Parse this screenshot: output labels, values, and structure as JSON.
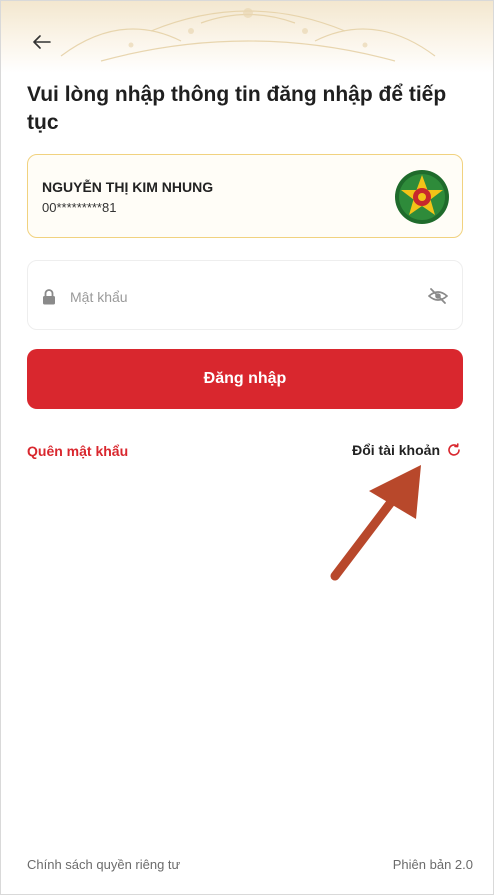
{
  "header": {
    "back_icon": "arrow-left-icon"
  },
  "title": "Vui lòng nhập thông tin đăng nhập để tiếp tục",
  "account": {
    "name": "NGUYỄN THỊ KIM NHUNG",
    "number": "00*********81",
    "emblem_icon": "customs-emblem-icon"
  },
  "password": {
    "placeholder": "Mật khẩu",
    "value": "",
    "lock_icon": "lock-icon",
    "toggle_icon": "eye-off-icon"
  },
  "login_button": {
    "label": "Đăng nhập"
  },
  "links": {
    "forgot_password": "Quên mật khẩu",
    "switch_account": "Đổi tài khoản",
    "switch_icon": "refresh-icon"
  },
  "footer": {
    "privacy": "Chính sách quyền riêng tư",
    "version": "Phiên bản 2.0"
  },
  "colors": {
    "primary": "#d9272e",
    "card_border": "#f1d27f",
    "arrow_annotation": "#b8482b"
  }
}
